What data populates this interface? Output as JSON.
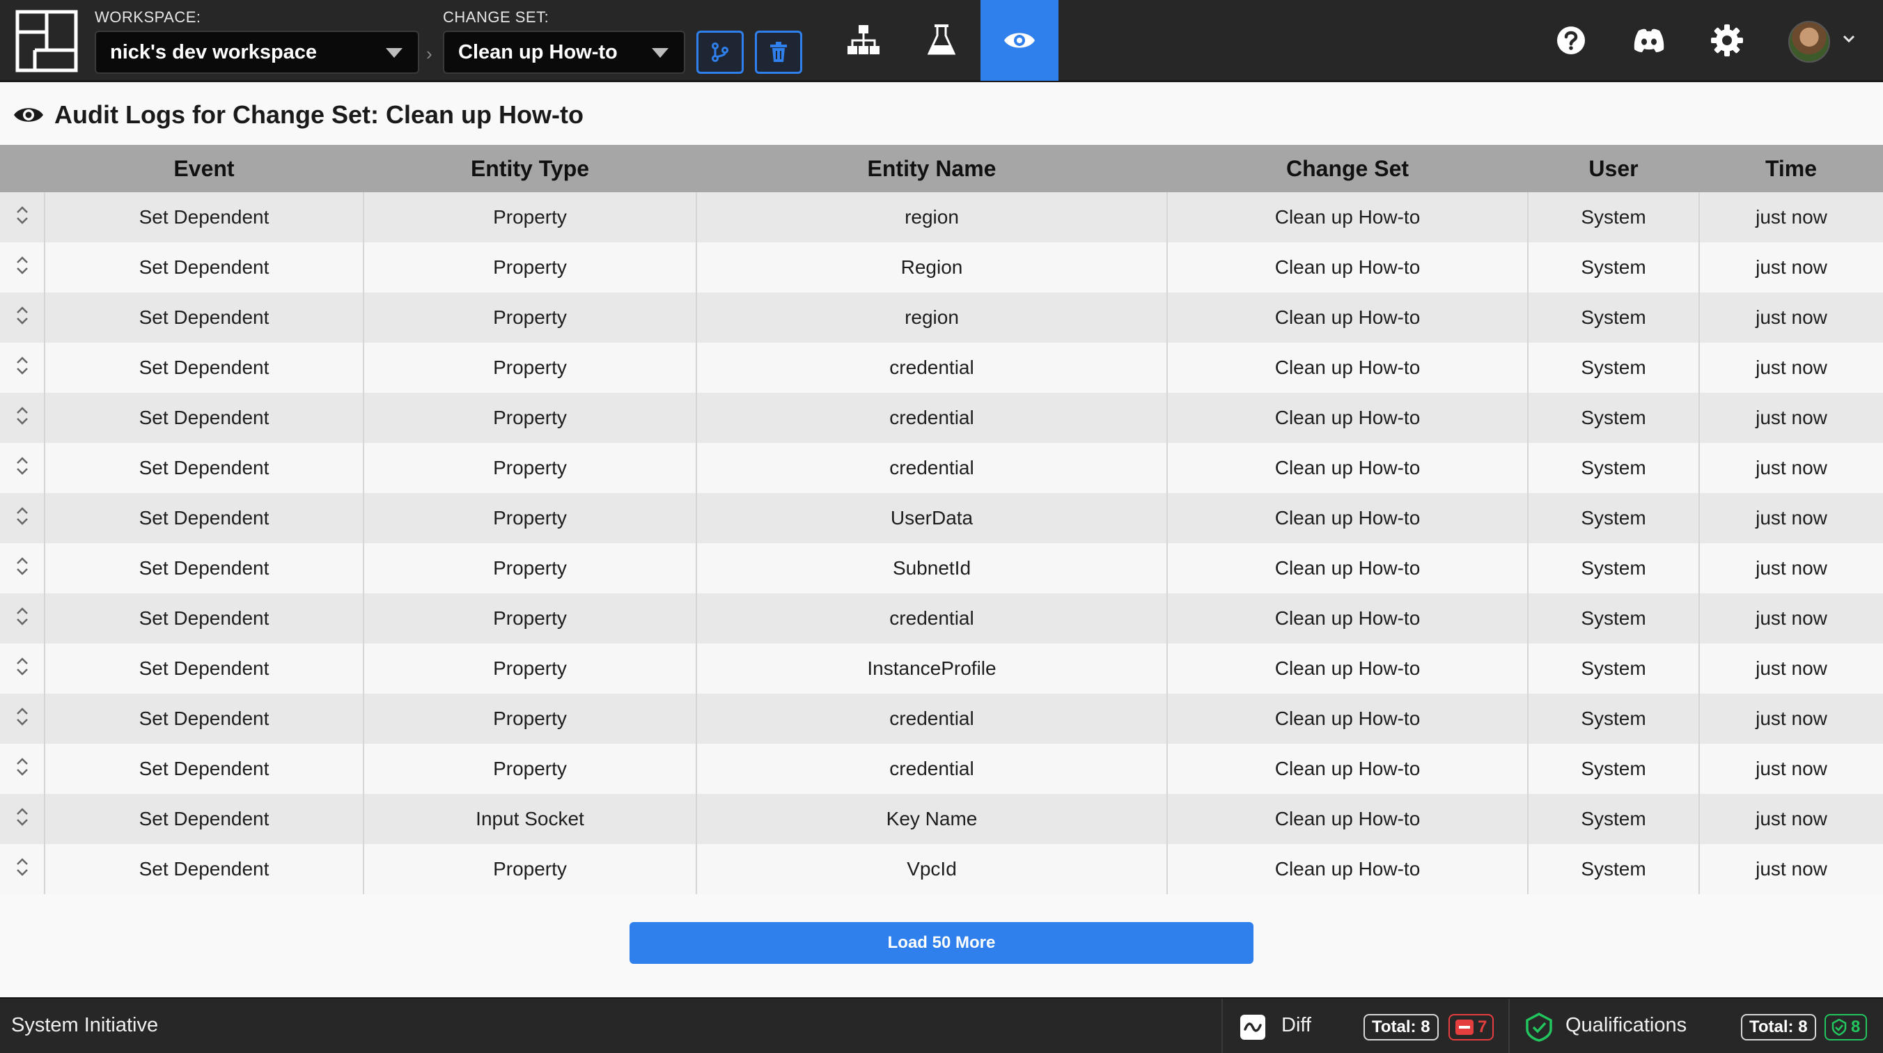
{
  "header": {
    "workspace_label": "WORKSPACE:",
    "workspace_value": "nick's dev workspace",
    "changeset_label": "CHANGE SET:",
    "changeset_value": "Clean up How-to",
    "breadcrumb_sep": "›"
  },
  "colors": {
    "accent": "#2f80ed",
    "nav_bg": "#272727",
    "danger": "#e53e3e",
    "success": "#22c55e"
  },
  "page": {
    "title": "Audit Logs for Change Set: Clean up How-to"
  },
  "table": {
    "columns": [
      "Event",
      "Entity Type",
      "Entity Name",
      "Change Set",
      "User",
      "Time"
    ],
    "rows": [
      {
        "event": "Set Dependent",
        "entity_type": "Property",
        "entity_name": "region",
        "change_set": "Clean up How-to",
        "user": "System",
        "time": "just now"
      },
      {
        "event": "Set Dependent",
        "entity_type": "Property",
        "entity_name": "Region",
        "change_set": "Clean up How-to",
        "user": "System",
        "time": "just now"
      },
      {
        "event": "Set Dependent",
        "entity_type": "Property",
        "entity_name": "region",
        "change_set": "Clean up How-to",
        "user": "System",
        "time": "just now"
      },
      {
        "event": "Set Dependent",
        "entity_type": "Property",
        "entity_name": "credential",
        "change_set": "Clean up How-to",
        "user": "System",
        "time": "just now"
      },
      {
        "event": "Set Dependent",
        "entity_type": "Property",
        "entity_name": "credential",
        "change_set": "Clean up How-to",
        "user": "System",
        "time": "just now"
      },
      {
        "event": "Set Dependent",
        "entity_type": "Property",
        "entity_name": "credential",
        "change_set": "Clean up How-to",
        "user": "System",
        "time": "just now"
      },
      {
        "event": "Set Dependent",
        "entity_type": "Property",
        "entity_name": "UserData",
        "change_set": "Clean up How-to",
        "user": "System",
        "time": "just now"
      },
      {
        "event": "Set Dependent",
        "entity_type": "Property",
        "entity_name": "SubnetId",
        "change_set": "Clean up How-to",
        "user": "System",
        "time": "just now"
      },
      {
        "event": "Set Dependent",
        "entity_type": "Property",
        "entity_name": "credential",
        "change_set": "Clean up How-to",
        "user": "System",
        "time": "just now"
      },
      {
        "event": "Set Dependent",
        "entity_type": "Property",
        "entity_name": "InstanceProfile",
        "change_set": "Clean up How-to",
        "user": "System",
        "time": "just now"
      },
      {
        "event": "Set Dependent",
        "entity_type": "Property",
        "entity_name": "credential",
        "change_set": "Clean up How-to",
        "user": "System",
        "time": "just now"
      },
      {
        "event": "Set Dependent",
        "entity_type": "Property",
        "entity_name": "credential",
        "change_set": "Clean up How-to",
        "user": "System",
        "time": "just now"
      },
      {
        "event": "Set Dependent",
        "entity_type": "Input Socket",
        "entity_name": "Key Name",
        "change_set": "Clean up How-to",
        "user": "System",
        "time": "just now"
      },
      {
        "event": "Set Dependent",
        "entity_type": "Property",
        "entity_name": "VpcId",
        "change_set": "Clean up How-to",
        "user": "System",
        "time": "just now"
      }
    ]
  },
  "load_more_label": "Load 50 More",
  "status": {
    "brand": "System Initiative",
    "diff_label": "Diff",
    "diff_total_label": "Total:",
    "diff_total": "8",
    "diff_removed": "7",
    "qual_label": "Qualifications",
    "qual_total_label": "Total:",
    "qual_total": "8",
    "qual_passed": "8"
  }
}
